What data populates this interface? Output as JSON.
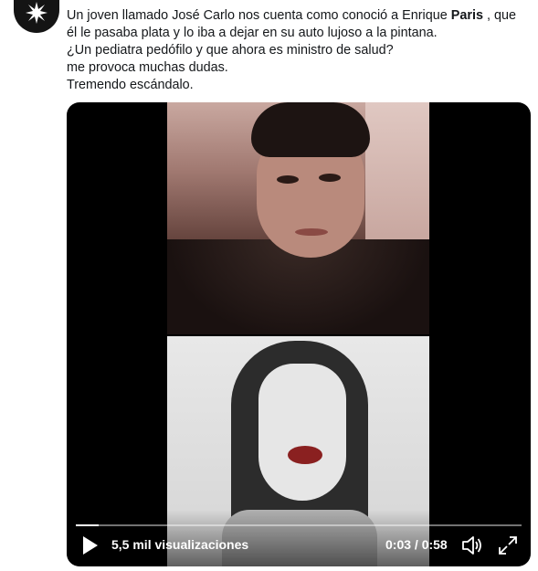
{
  "tweet": {
    "text_lines": [
      {
        "before": "Un joven llamado José Carlo nos cuenta como conoció a Enrique ",
        "bold": "Paris",
        "after": " , que"
      },
      {
        "before": "él le pasaba plata y lo iba a dejar en su auto lujoso a la pintana.",
        "bold": "",
        "after": ""
      },
      {
        "before": "¿Un pediatra pedófilo y que ahora es ministro de salud?",
        "bold": "",
        "after": ""
      },
      {
        "before": "me provoca muchas dudas.",
        "bold": "",
        "after": ""
      },
      {
        "before": "Tremendo escándalo.",
        "bold": "",
        "after": ""
      }
    ]
  },
  "avatar": {
    "icon": "starburst-icon",
    "color": "#141414"
  },
  "video": {
    "views_label": "5,5 mil visualizaciones",
    "time_label": "0:03 / 0:58",
    "progress": 0.052,
    "play_icon": "play-icon",
    "volume_icon": "volume-icon",
    "fullscreen_icon": "fullscreen-icon"
  },
  "colors": {
    "text": "#14171a",
    "video_bg": "#000000",
    "control_text": "#ffffff"
  }
}
